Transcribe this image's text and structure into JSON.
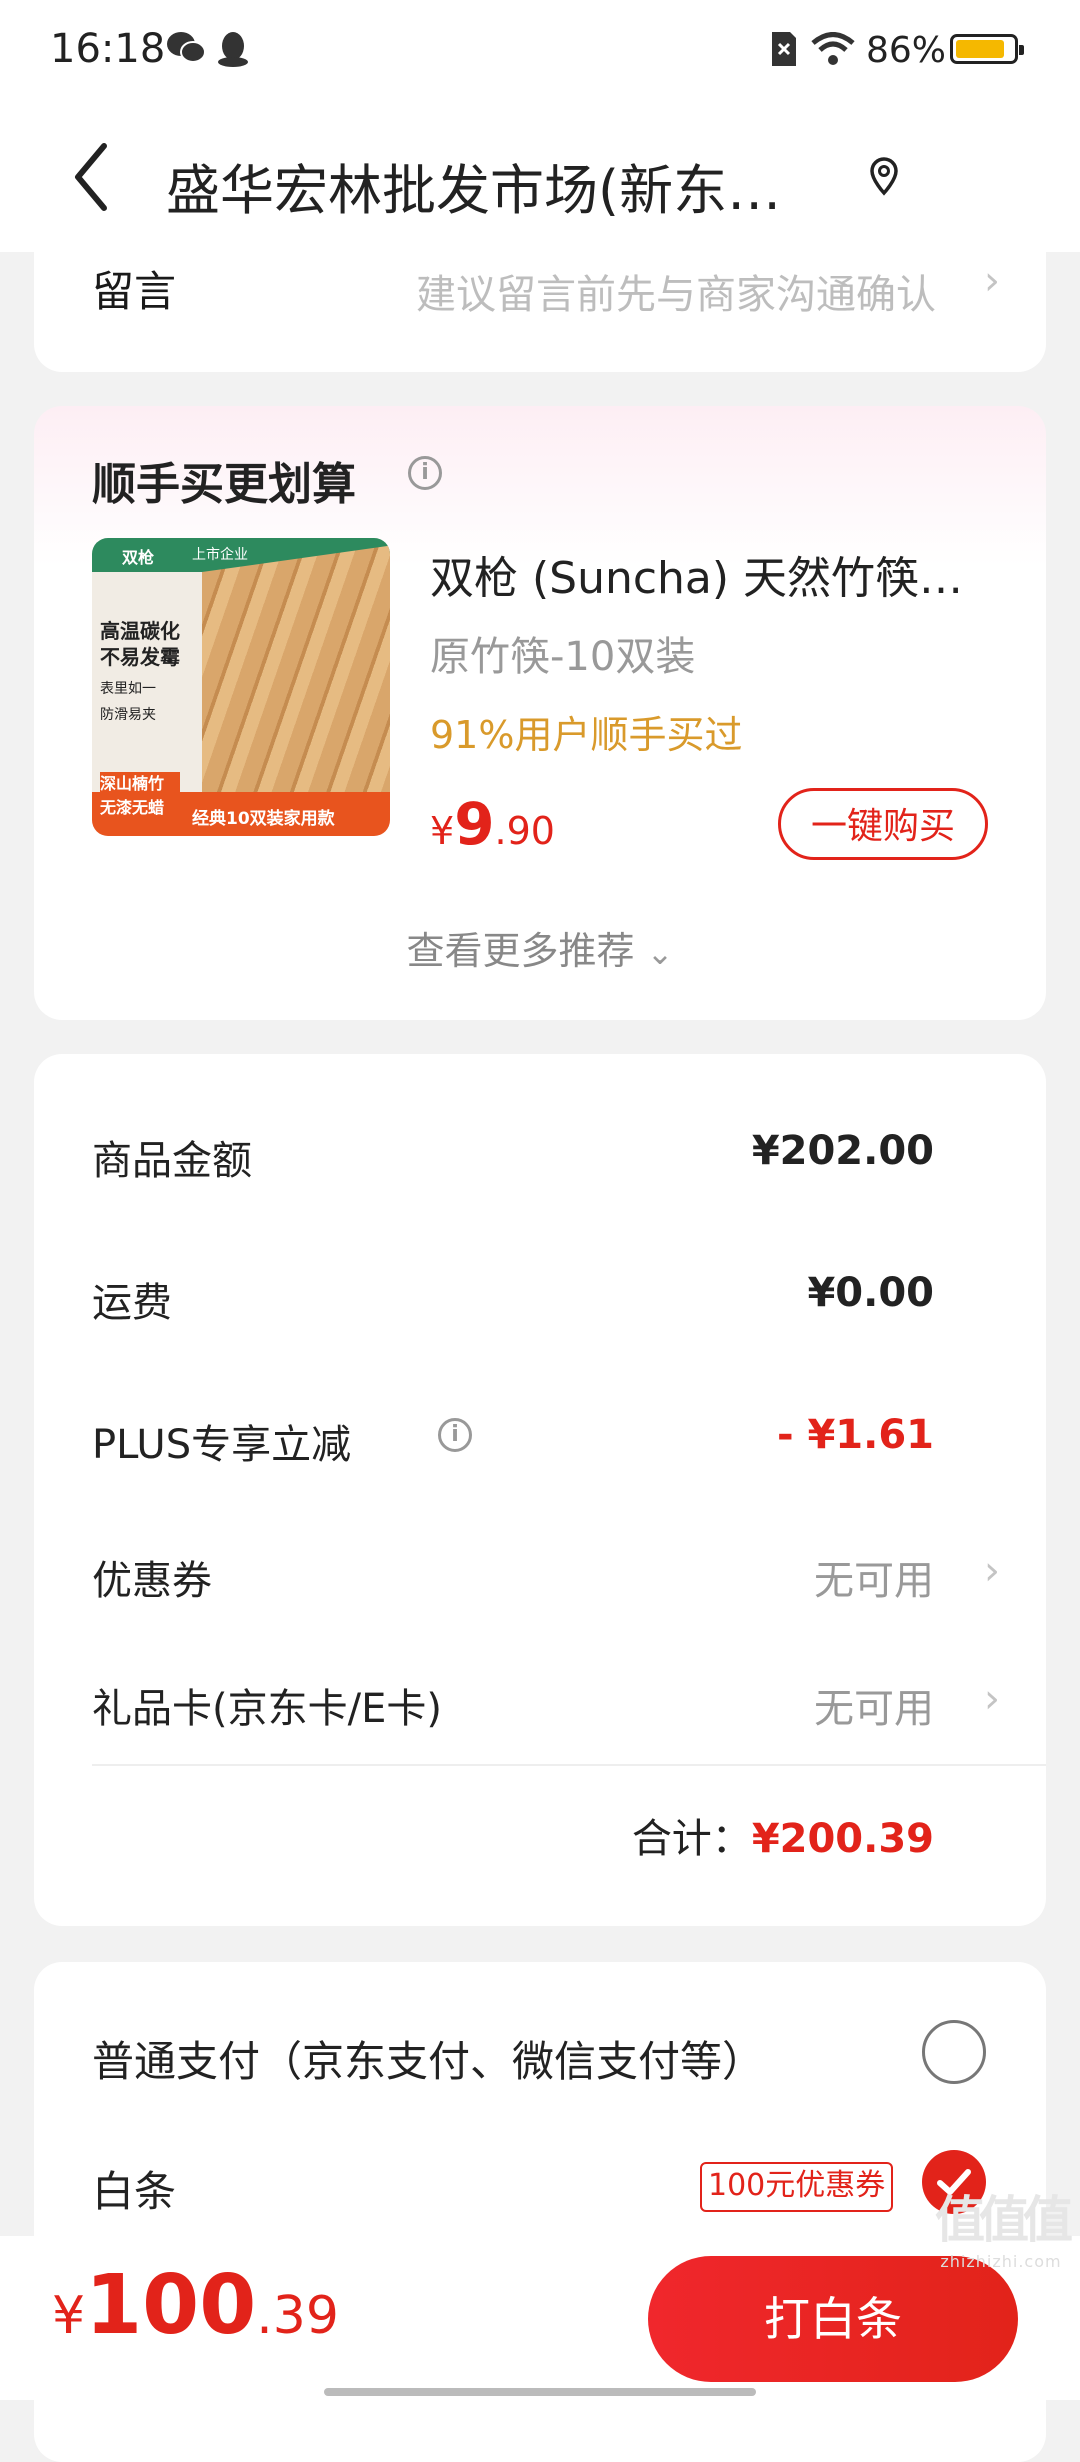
{
  "status_bar": {
    "time": "16:18",
    "battery": "86%",
    "icons": [
      "wechat-icon",
      "qq-icon",
      "sim-icon",
      "wifi-icon"
    ]
  },
  "header": {
    "title": "盛华宏林批发市场(新东…",
    "back_icon": "back-icon",
    "location_icon": "location-icon"
  },
  "note": {
    "label": "留言",
    "hint": "建议留言前先与商家沟通确认",
    "chevron": "›"
  },
  "recommend": {
    "title": "顺手买更划算",
    "info_icon": "i",
    "product": {
      "name": "双枪 (Suncha) 天然竹筷…",
      "spec": "原竹筷-10双装",
      "social_proof": "91%用户顺手买过",
      "price_currency": "¥",
      "price_int": "9",
      "price_dec": ".90",
      "buy_label": "一键购买",
      "image_text": {
        "brand": "双枪",
        "corp": "上市企业",
        "line1": "高温碳化",
        "line2": "不易发霉",
        "line3": "表里如一",
        "line4": "防滑易夹",
        "badge1": "深山楠竹",
        "badge2": "无漆无蜡",
        "footer": "经典10双装家用款"
      }
    },
    "more_label": "查看更多推荐",
    "more_icon": "⌄"
  },
  "fees": {
    "rows": [
      {
        "label": "商品金额",
        "value": "¥202.00"
      },
      {
        "label": "运费",
        "value": "¥0.00"
      },
      {
        "label": "PLUS专享立减",
        "value": "- ¥1.61"
      },
      {
        "label": "优惠券",
        "value": "无可用"
      },
      {
        "label": "礼品卡(京东卡/E卡)",
        "value": "无可用"
      }
    ],
    "total_label": "合计：",
    "total_value": "¥200.39"
  },
  "payment": {
    "options": [
      {
        "label": "普通支付（京东支付、微信支付等）",
        "selected": false
      },
      {
        "label": "白条",
        "selected": true,
        "tag": "100元优惠券"
      }
    ]
  },
  "bottom": {
    "price_currency": "¥",
    "price_int": "100",
    "price_dec": ".39",
    "pay_label": "打白条"
  },
  "watermark": {
    "main": "值值值",
    "sub": "zhizhizhi.com"
  },
  "colors": {
    "accent": "#e2231a",
    "social": "#d99a2b",
    "battery": "#f5b800"
  }
}
